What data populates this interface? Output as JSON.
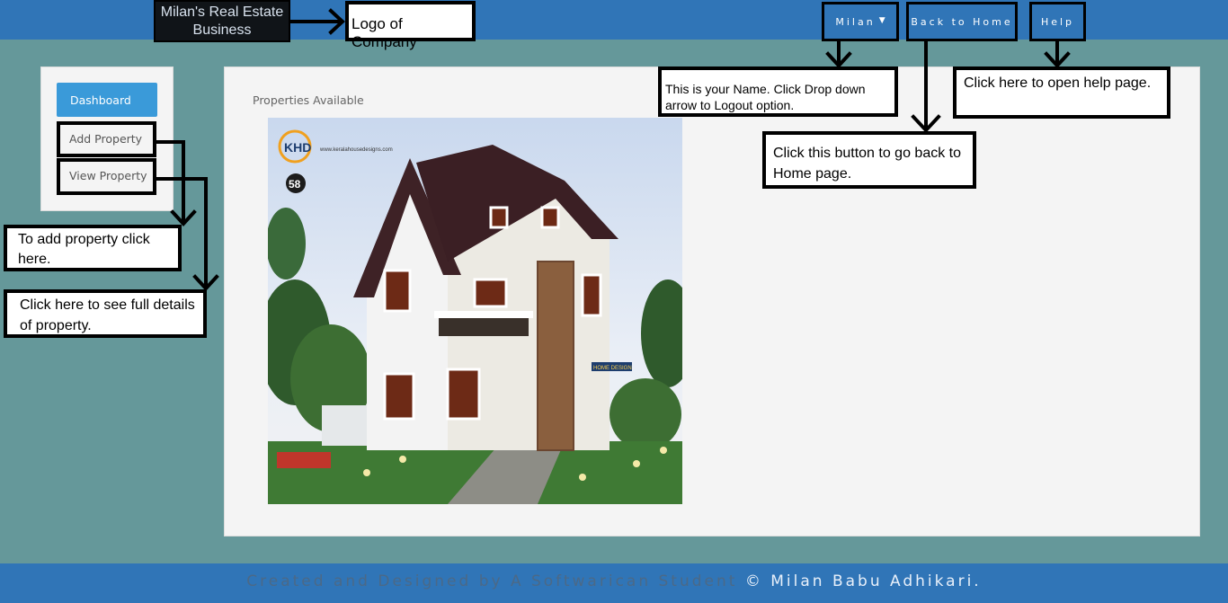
{
  "header": {
    "logo_text": "Milan's Real Estate Business",
    "logo_callout": "Logo of Company",
    "nav": {
      "user_label": "Milan",
      "home_label": "Back to Home",
      "help_label": "Help"
    }
  },
  "callouts": {
    "user": "This is your Name. Click Drop down arrow to Logout option.",
    "home": "Click this button to go back to Home page.",
    "help": "Click here to open help page.",
    "add": "To add property click here.",
    "view": "Click here to see full details of property."
  },
  "sidebar": {
    "items": [
      {
        "label": "Dashboard"
      },
      {
        "label": "Add Property"
      },
      {
        "label": "View Property"
      }
    ]
  },
  "main": {
    "title": "Properties Available",
    "image": {
      "logo_text": "KHD",
      "site_text": "www.keralahousedesigns.com",
      "badge": "58",
      "sign_text": "HOME DESIGN"
    }
  },
  "footer": {
    "credit": "Created and Designed by A Softwarican Student",
    "copyright": "© Milan Babu Adhikari."
  },
  "colors": {
    "header": "#3075b7",
    "background": "#65989a",
    "accent": "#3a9ad9"
  }
}
